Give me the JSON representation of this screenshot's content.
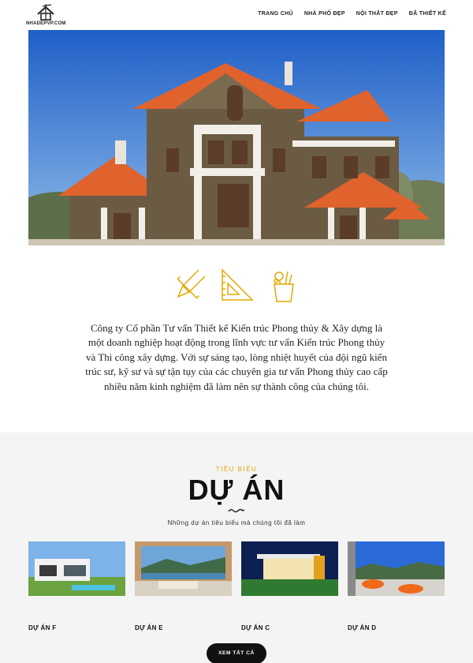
{
  "header": {
    "logo_text": "NHADEPVP.COM",
    "nav": [
      "TRANG CHỦ",
      "NHÀ PHỐ ĐẸP",
      "NỘI THẤT ĐẸP",
      "ĐÃ THIẾT KẾ"
    ]
  },
  "intro": {
    "text": "Công ty Cổ phần Tư vấn Thiết kế Kiến trúc Phong thủy & Xây dựng là một doanh nghiệp hoạt động trong lĩnh vực tư vấn Kiến trúc Phong thủy và Thi công xây dựng. Với sự sáng tạo, lòng nhiệt huyết của đội ngũ kiến trúc sư, kỹ sư và sự tận tụy của các chuyên gia tư vấn Phong thủy cao cấp nhiều năm kinh nghiệm đã làm nên sự thành công của chúng tôi."
  },
  "projects": {
    "kicker": "TIÊU BIỂU",
    "title": "DỰ ÁN",
    "subtitle": "Những dự án tiêu biểu mà chúng tôi đã làm",
    "items": [
      {
        "name": "DỰ ÁN F"
      },
      {
        "name": "DỰ ÁN E"
      },
      {
        "name": "DỰ ÁN C"
      },
      {
        "name": "DỰ ÁN D"
      }
    ],
    "button_label": "XEM TẤT CẢ"
  },
  "colors": {
    "accent": "#e0a800",
    "roof": "#e0622c",
    "sky": "#2f6fd0",
    "section_bg": "#f4f4f4"
  }
}
